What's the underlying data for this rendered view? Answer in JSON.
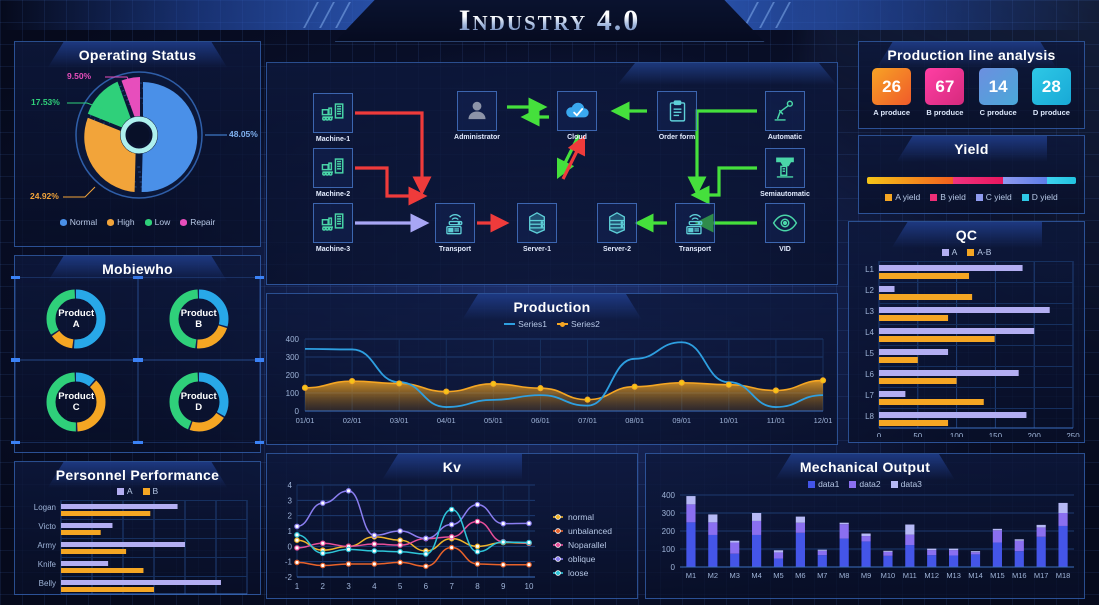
{
  "header": {
    "title": "Industry 4.0"
  },
  "panels": {
    "operating_status": {
      "title": "Operating Status",
      "legend": [
        {
          "label": "Normal",
          "color": "#4a90e8"
        },
        {
          "label": "High",
          "color": "#f2a43a"
        },
        {
          "label": "Low",
          "color": "#2fd07a"
        },
        {
          "label": "Repair",
          "color": "#e74ebc"
        }
      ]
    },
    "mobiewho": {
      "title": "Mobiewho",
      "items": [
        {
          "name": "Product",
          "sub": "A",
          "blue": 52,
          "orange": 14,
          "green": 34
        },
        {
          "name": "Product",
          "sub": "B",
          "blue": 30,
          "orange": 22,
          "green": 48
        },
        {
          "name": "Product",
          "sub": "C",
          "blue": 12,
          "orange": 38,
          "green": 50
        },
        {
          "name": "Product",
          "sub": "D",
          "blue": 34,
          "orange": 22,
          "green": 44
        }
      ],
      "ring_colors": {
        "blue": "#28a8e8",
        "orange": "#f5a623",
        "green": "#2fd07a"
      }
    },
    "personnel_performance": {
      "title": "Personnel Performance"
    },
    "flow": {
      "nodes": [
        {
          "id": "machine1",
          "label": "Machine-1",
          "icon": "factory-machine-icon"
        },
        {
          "id": "machine2",
          "label": "Machine-2",
          "icon": "factory-machine-icon"
        },
        {
          "id": "machine3",
          "label": "Machine-3",
          "icon": "factory-machine-icon"
        },
        {
          "id": "administrator",
          "label": "Administrator",
          "icon": "user-icon"
        },
        {
          "id": "cloud",
          "label": "Cloud",
          "icon": "cloud-check-icon"
        },
        {
          "id": "orderform",
          "label": "Order form",
          "icon": "clipboard-icon"
        },
        {
          "id": "automatic",
          "label": "Automatic",
          "icon": "robot-arm-icon"
        },
        {
          "id": "semiautomatic",
          "label": "Semiautomatic",
          "icon": "press-machine-icon"
        },
        {
          "id": "vid",
          "label": "VID",
          "icon": "eye-icon"
        },
        {
          "id": "transport1",
          "label": "Transport",
          "icon": "router-icon"
        },
        {
          "id": "server1",
          "label": "Server-1",
          "icon": "server-icon"
        },
        {
          "id": "server2",
          "label": "Server-2",
          "icon": "server-icon"
        },
        {
          "id": "transport2",
          "label": "Transport",
          "icon": "router-icon"
        }
      ],
      "arrow_colors": {
        "red": "#ef3b3b",
        "green": "#45e03c",
        "purple": "#a8a6f5"
      }
    },
    "production": {
      "title": "Production"
    },
    "kv": {
      "title": "Kv"
    },
    "mechanical_output": {
      "title": "Mechanical Output"
    },
    "production_line_analysis": {
      "title": "Production line analysis",
      "cells": [
        {
          "value": "26",
          "caption": "A produce",
          "c1": "#f7a325",
          "c2": "#f05a2a"
        },
        {
          "value": "67",
          "caption": "B produce",
          "c1": "#ff3fa4",
          "c2": "#d62a7d"
        },
        {
          "value": "14",
          "caption": "C produce",
          "c1": "#6c8fe0",
          "c2": "#4aa8d8"
        },
        {
          "value": "28",
          "caption": "D produce",
          "c1": "#2ec8e6",
          "c2": "#18a9d6"
        }
      ]
    },
    "yield": {
      "title": "Yield",
      "segments": [
        {
          "label": "A yield",
          "width": 41,
          "from": "#f5c518",
          "to": "#f3601f",
          "swatch": "#f5a623"
        },
        {
          "label": "B yield",
          "width": 24,
          "from": "#f0347f",
          "to": "#e8165e",
          "swatch": "#ee2e77"
        },
        {
          "label": "C yield",
          "width": 21,
          "from": "#8f9bf0",
          "to": "#5d7de8",
          "swatch": "#8f9bf0"
        },
        {
          "label": "D yield",
          "width": 14,
          "from": "#3fd3ef",
          "to": "#21c3e0",
          "swatch": "#2ec8e6"
        }
      ]
    },
    "qc": {
      "title": "QC"
    }
  },
  "chart_data": [
    {
      "id": "operating-status",
      "type": "pie",
      "title": "Operating Status",
      "labels": [
        "Normal",
        "High",
        "Low",
        "Repair"
      ],
      "values": [
        48.05,
        24.92,
        17.53,
        9.5
      ],
      "value_labels": [
        "48.05%",
        "24.92%",
        "17.53%",
        "9.50%"
      ],
      "colors": [
        "#4a90e8",
        "#f2a43a",
        "#2fd07a",
        "#e74ebc"
      ],
      "legend_position": "bottom"
    },
    {
      "id": "personnel-performance",
      "type": "bar",
      "orientation": "horizontal",
      "title": "Personnel Performance",
      "categories": [
        "Logan",
        "Victo",
        "Army",
        "Knife",
        "Belly"
      ],
      "series": [
        {
          "name": "A",
          "color": "#b3aef2",
          "values": [
            188,
            83,
            200,
            76,
            258
          ]
        },
        {
          "name": "B",
          "color": "#f5a623",
          "values": [
            144,
            64,
            105,
            133,
            150
          ]
        }
      ],
      "xlim": [
        0,
        300
      ],
      "xticks": [
        0,
        50,
        100,
        150,
        200,
        250,
        300
      ],
      "grid": true,
      "legend_position": "top"
    },
    {
      "id": "production",
      "type": "area",
      "title": "Production",
      "categories": [
        "01/01",
        "02/01",
        "03/01",
        "04/01",
        "05/01",
        "06/01",
        "07/01",
        "08/01",
        "09/01",
        "10/01",
        "11/01",
        "12/01"
      ],
      "series": [
        {
          "name": "Series1",
          "color": "#2e9fe0",
          "values": [
            345,
            342,
            160,
            22,
            62,
            88,
            30,
            290,
            382,
            160,
            22,
            88
          ]
        },
        {
          "name": "Series2",
          "color": "#f5a623",
          "values": [
            129,
            166,
            153,
            108,
            151,
            127,
            63,
            135,
            157,
            146,
            114,
            170
          ]
        }
      ],
      "ylim": [
        0,
        400
      ],
      "yticks": [
        0,
        100,
        200,
        300,
        400
      ],
      "grid": true,
      "legend_position": "top"
    },
    {
      "id": "kv",
      "type": "line",
      "title": "Kv",
      "x": [
        1,
        2,
        3,
        4,
        5,
        6,
        7,
        8,
        9,
        10
      ],
      "series": [
        {
          "name": "normal",
          "color": "#f0b429",
          "values": [
            0.4,
            -0.25,
            0.0,
            0.62,
            0.4,
            -0.3,
            0.5,
            0.0,
            0.25,
            0.2
          ]
        },
        {
          "name": "unbalanced",
          "color": "#e8622a",
          "values": [
            -1.05,
            -1.25,
            -1.15,
            -1.15,
            -1.05,
            -1.3,
            -0.08,
            -1.15,
            -1.2,
            -1.2
          ]
        },
        {
          "name": "Noparallel",
          "color": "#e84f9a",
          "values": [
            -0.1,
            0.2,
            0.0,
            0.15,
            0.08,
            0.5,
            0.62,
            1.62,
            0.3,
            0.22
          ]
        },
        {
          "name": "oblique",
          "color": "#8b7ef0",
          "values": [
            1.3,
            2.82,
            3.62,
            0.72,
            1.0,
            0.52,
            1.42,
            2.72,
            1.48,
            1.5
          ]
        },
        {
          "name": "loose",
          "color": "#2ec5d8",
          "values": [
            0.75,
            -0.45,
            -0.2,
            -0.3,
            -0.35,
            -0.5,
            2.4,
            -0.35,
            0.28,
            0.25
          ]
        }
      ],
      "ylim": [
        -2,
        4
      ],
      "yticks": [
        -2,
        -1,
        0,
        1,
        2,
        3,
        4
      ],
      "grid": true,
      "legend_position": "right"
    },
    {
      "id": "mechanical-output",
      "type": "bar",
      "stacked": true,
      "title": "Mechanical Output",
      "categories": [
        "M1",
        "M2",
        "M3",
        "M4",
        "M5",
        "M6",
        "M7",
        "M8",
        "M9",
        "M10",
        "M11",
        "M12",
        "M13",
        "M14",
        "M15",
        "M16",
        "M17",
        "M18"
      ],
      "series": [
        {
          "name": "data1",
          "color": "#4455e8",
          "values": [
            248,
            178,
            74,
            178,
            47,
            190,
            66,
            158,
            142,
            62,
            122,
            66,
            64,
            70,
            136,
            88,
            168,
            228
          ]
        },
        {
          "name": "data2",
          "color": "#8a6ff0",
          "values": [
            100,
            70,
            62,
            78,
            34,
            56,
            24,
            80,
            30,
            22,
            58,
            28,
            30,
            12,
            68,
            58,
            52,
            72
          ]
        },
        {
          "name": "data3",
          "color": "#b6b9f5",
          "values": [
            46,
            44,
            10,
            44,
            12,
            34,
            6,
            8,
            14,
            6,
            56,
            8,
            8,
            6,
            8,
            8,
            14,
            56
          ]
        }
      ],
      "ylim": [
        0,
        400
      ],
      "yticks": [
        0,
        100,
        200,
        300,
        400
      ],
      "grid": true,
      "legend_position": "top"
    },
    {
      "id": "qc",
      "type": "bar",
      "orientation": "horizontal",
      "title": "QC",
      "categories": [
        "L1",
        "L2",
        "L3",
        "L4",
        "L5",
        "L6",
        "L7",
        "L8"
      ],
      "series": [
        {
          "name": "A",
          "color": "#b3aef2",
          "values": [
            185,
            20,
            220,
            200,
            89,
            180,
            34,
            190
          ]
        },
        {
          "name": "A-B",
          "color": "#f5a623",
          "values": [
            116,
            120,
            89,
            149,
            50,
            100,
            135,
            89
          ]
        }
      ],
      "xlim": [
        0,
        250
      ],
      "xticks": [
        0,
        50,
        100,
        150,
        200,
        250
      ],
      "grid": true,
      "legend_position": "top"
    }
  ]
}
